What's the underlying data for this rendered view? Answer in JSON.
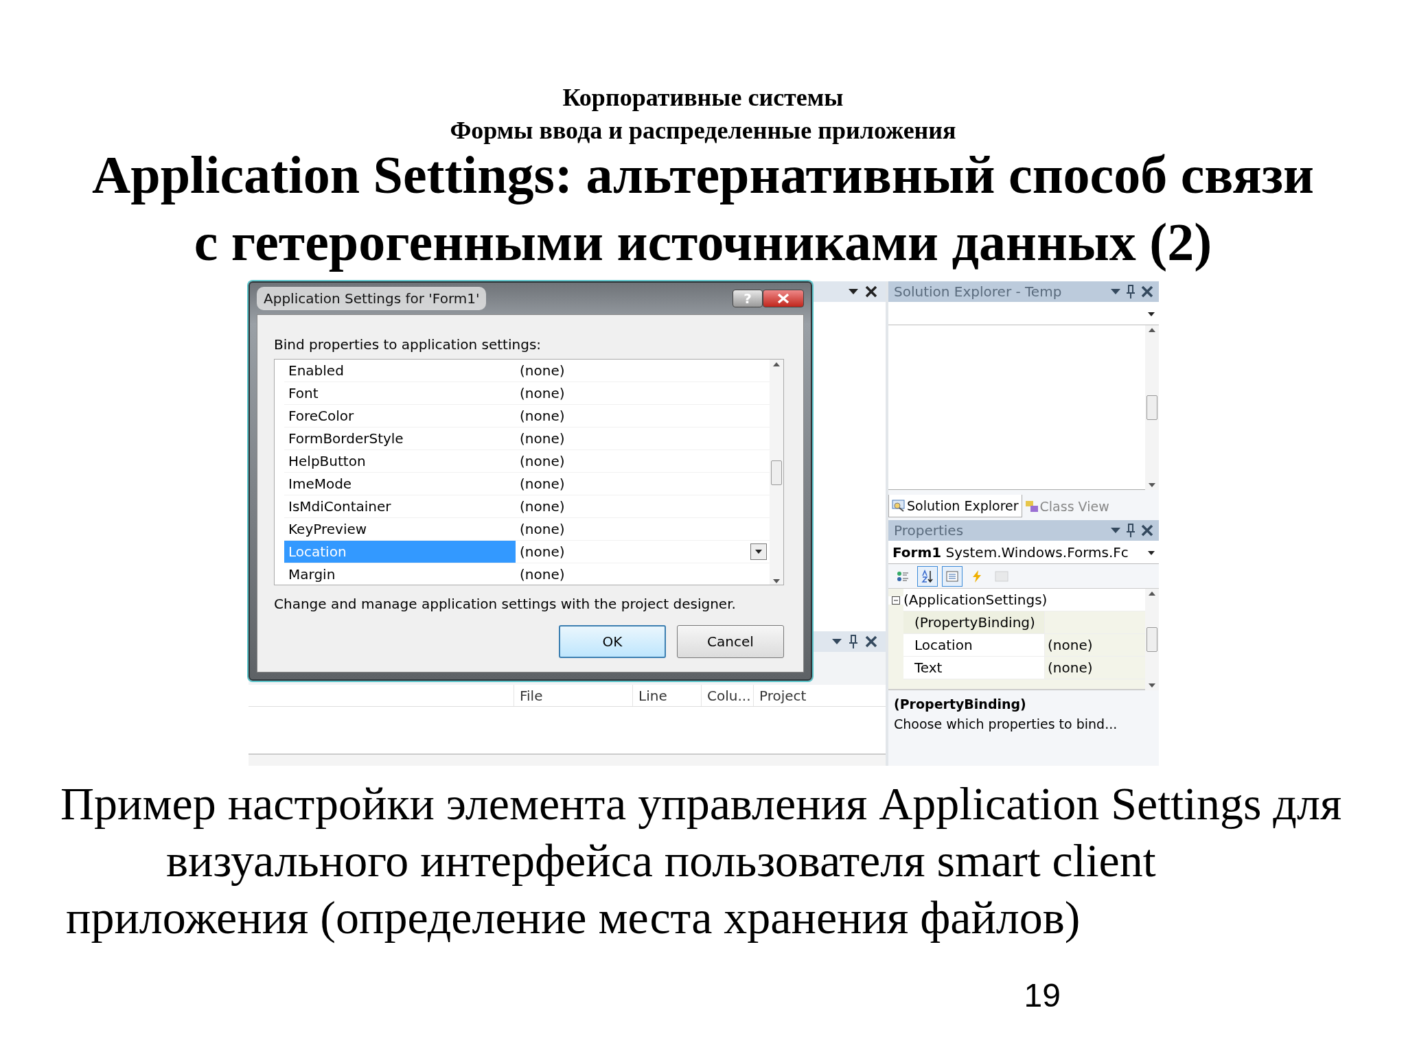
{
  "slide": {
    "header": [
      "Корпоративные системы",
      "Формы ввода и распределенные приложения"
    ],
    "title": [
      "Application Settings: альтернативный способ связи",
      "с гетерогенными источниками данных (2)"
    ],
    "caption": [
      "Пример настройки элемента управления Application Settings для",
      "визуального интерфейса пользователя smart client",
      "приложения (определение места хранения файлов)"
    ],
    "page_number": "19"
  },
  "dialog": {
    "title": "Application Settings for 'Form1'",
    "help_button": "?",
    "label": "Bind properties to application settings:",
    "rows": [
      {
        "property": "Enabled",
        "value": "(none)",
        "selected": false
      },
      {
        "property": "Font",
        "value": "(none)",
        "selected": false
      },
      {
        "property": "ForeColor",
        "value": "(none)",
        "selected": false
      },
      {
        "property": "FormBorderStyle",
        "value": "(none)",
        "selected": false
      },
      {
        "property": "HelpButton",
        "value": "(none)",
        "selected": false
      },
      {
        "property": "ImeMode",
        "value": "(none)",
        "selected": false
      },
      {
        "property": "IsMdiContainer",
        "value": "(none)",
        "selected": false
      },
      {
        "property": "KeyPreview",
        "value": "(none)",
        "selected": false
      },
      {
        "property": "Location",
        "value": "(none)",
        "selected": true
      },
      {
        "property": "Margin",
        "value": "(none)",
        "selected": false
      }
    ],
    "note": "Change and manage application settings with the project designer.",
    "buttons": [
      {
        "label": "OK",
        "default": true
      },
      {
        "label": "Cancel",
        "default": false
      }
    ]
  },
  "error_list": {
    "columns": [
      "File",
      "Line",
      "Colu...",
      "Project"
    ]
  },
  "solution_explorer": {
    "title": "Solution Explorer - Temp",
    "tabs": [
      {
        "label": "Solution Explorer",
        "selected": true
      },
      {
        "label": "Class View",
        "selected": false
      }
    ]
  },
  "properties": {
    "title": "Properties",
    "object": {
      "name": "Form1",
      "type": "System.Windows.Forms.Fc"
    },
    "toolbar": [
      {
        "kind": "categorized",
        "selected": false,
        "disabled": false
      },
      {
        "kind": "alphabetical",
        "selected": true,
        "disabled": false
      },
      {
        "kind": "properties",
        "selected": true,
        "disabled": false
      },
      {
        "kind": "events",
        "selected": false,
        "disabled": false
      },
      {
        "kind": "pages",
        "selected": false,
        "disabled": true
      }
    ],
    "rows": [
      {
        "kind": "category",
        "name": "(ApplicationSettings)",
        "expanded": true,
        "selected": false
      },
      {
        "kind": "property",
        "name": "(PropertyBinding)",
        "value": "",
        "selected": true
      },
      {
        "kind": "property",
        "name": "Location",
        "value": "(none)",
        "selected": false
      },
      {
        "kind": "property",
        "name": "Text",
        "value": "(none)",
        "selected": false
      }
    ],
    "description": {
      "title": "(PropertyBinding)",
      "text": "Choose which properties to bind..."
    }
  }
}
